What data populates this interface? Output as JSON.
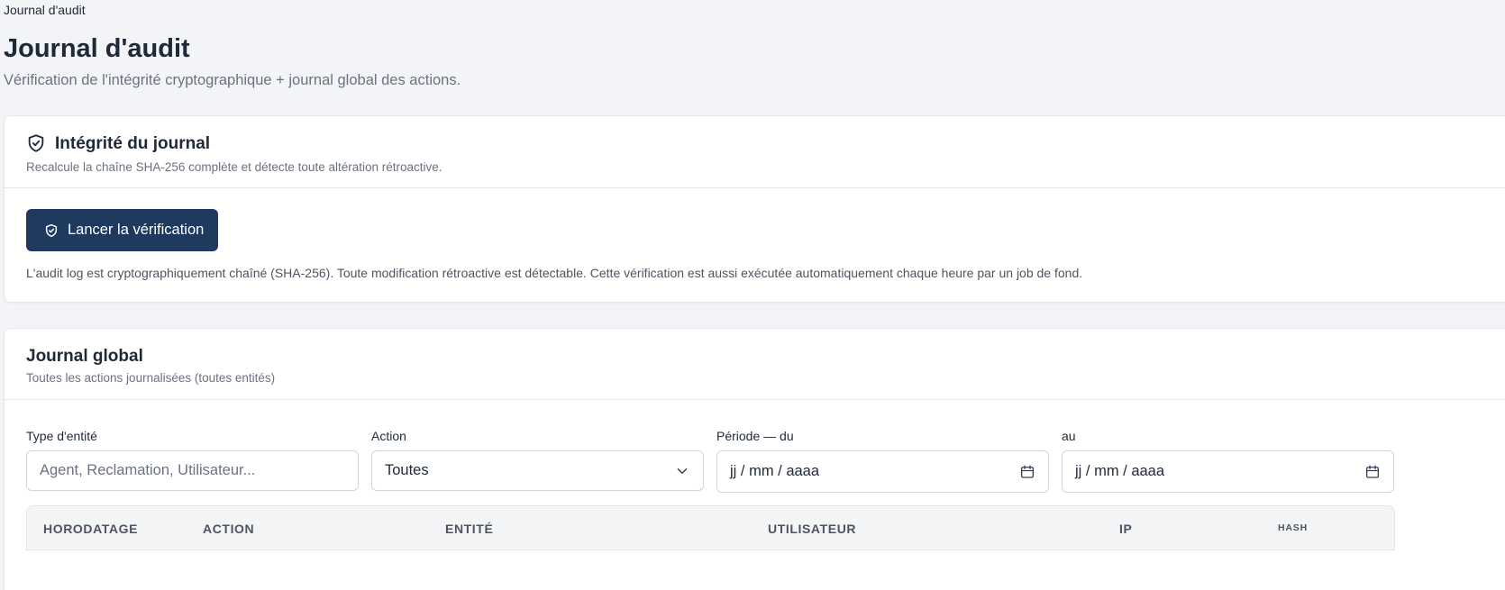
{
  "breadcrumb": "Journal d'audit",
  "page": {
    "title": "Journal d'audit",
    "subtitle": "Vérification de l'intégrité cryptographique + journal global des actions."
  },
  "integrity": {
    "title": "Intégrité du journal",
    "description": "Recalcule la chaîne SHA-256 complète et détecte toute altération rétroactive.",
    "button_label": "Lancer la vérification",
    "note": "L'audit log est cryptographiquement chaîné (SHA-256). Toute modification rétroactive est détectable. Cette vérification est aussi exécutée automatiquement chaque heure par un job de fond.",
    "icon": "shield-check-icon"
  },
  "global_log": {
    "title": "Journal global",
    "description": "Toutes les actions journalisées (toutes entités)",
    "filters": {
      "entity_type": {
        "label": "Type d'entité",
        "placeholder": "Agent, Reclamation, Utilisateur...",
        "value": ""
      },
      "action": {
        "label": "Action",
        "selected": "Toutes",
        "icon": "chevron-down-icon"
      },
      "period_from": {
        "label": "Période — du",
        "value": "jj / mm / aaaa",
        "icon": "calendar-icon"
      },
      "period_to": {
        "label": "au",
        "value": "jj / mm / aaaa",
        "icon": "calendar-icon"
      }
    },
    "table": {
      "columns": [
        "Horodatage",
        "Action",
        "Entité",
        "Utilisateur",
        "IP",
        "Hash"
      ]
    }
  },
  "colors": {
    "primary_button": "#1e3a5f",
    "background": "#f3f4f7",
    "card": "#ffffff",
    "muted_text": "#6b7280"
  }
}
